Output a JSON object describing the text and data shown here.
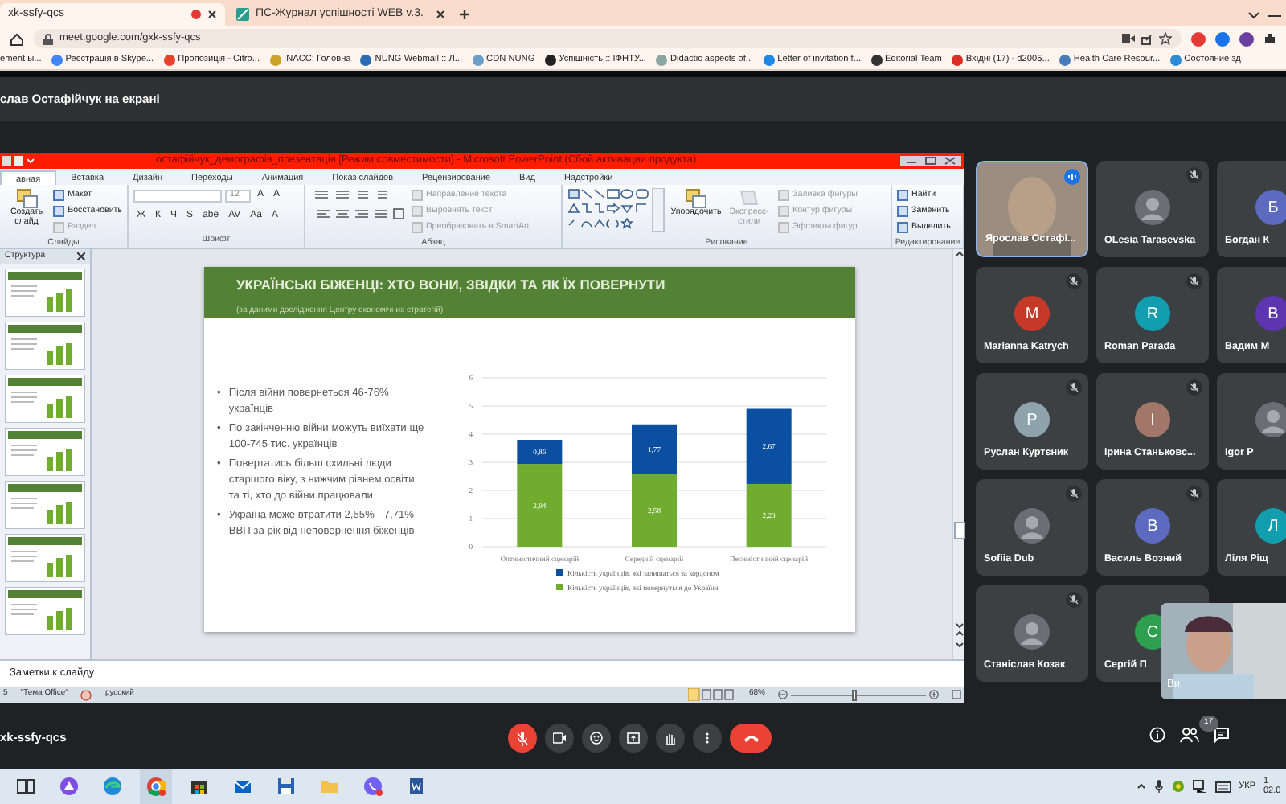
{
  "browser": {
    "tabs": [
      {
        "title": "xk-ssfy-qcs",
        "selected": true,
        "recording": true
      },
      {
        "title": "ПС-Журнал успішності WEB v.3.",
        "selected": false,
        "recording": false
      }
    ],
    "address": "meet.google.com/gxk-ssfy-qcs",
    "bookmarks": [
      {
        "label": "ement ы..."
      },
      {
        "label": "Реєстрація в Skype...",
        "color": "#4285f4"
      },
      {
        "label": "Пропозиція - Citro...",
        "color": "#e8412c"
      },
      {
        "label": "INACC: Головна",
        "color": "#c9a227"
      },
      {
        "label": "NUNG Webmail :: Л...",
        "color": "#2b6cb0"
      },
      {
        "label": "CDN NUNG",
        "color": "#6aa0c8"
      },
      {
        "label": "Успішність :: ІФНТУ...",
        "color": "#222222"
      },
      {
        "label": "Didactic aspects of...",
        "color": "#8aa8a0"
      },
      {
        "label": "Letter of invitation f...",
        "color": "#1e88e5"
      },
      {
        "label": "Editorial Team",
        "color": "#333333"
      },
      {
        "label": "Вхідні (17) - d2005...",
        "color": "#d93025"
      },
      {
        "label": "Health Care Resour...",
        "color": "#4a7bb7"
      },
      {
        "label": "Состояние зд",
        "color": "#2a8bd6"
      }
    ]
  },
  "meet": {
    "presenter_banner": "слав Остафійчук на екрані",
    "meeting_code": "xk-ssfy-qcs",
    "participant_count": "17",
    "self_label": "Ви",
    "mic_on": false
  },
  "powerpoint": {
    "title": "остафійчук_демографія_презентація [Режим совместимости]  -  Microsoft PowerPoint (Сбой активации продукта)",
    "tabs": [
      {
        "label": "авная",
        "selected": true
      },
      {
        "label": "Вставка",
        "selected": false
      },
      {
        "label": "Дизайн",
        "selected": false
      },
      {
        "label": "Переходы",
        "selected": false
      },
      {
        "label": "Анимация",
        "selected": false
      },
      {
        "label": "Показ слайдов",
        "selected": false
      },
      {
        "label": "Рецензирование",
        "selected": false
      },
      {
        "label": "Вид",
        "selected": false
      },
      {
        "label": "Надстройки",
        "selected": false
      }
    ],
    "ribbon": [
      {
        "label": "Слайды",
        "items": [
          {
            "kind": "large",
            "label": "Создать слайд",
            "disabled": false
          },
          {
            "kind": "stack",
            "entries": [
              {
                "label": "Макет",
                "disabled": false
              },
              {
                "label": "Восстановить",
                "disabled": false
              },
              {
                "label": "Раздел",
                "disabled": true
              }
            ]
          }
        ]
      },
      {
        "label": "Шрифт",
        "items": [
          {
            "kind": "font",
            "size": "12",
            "top_buttons": [
              "A",
              "A"
            ],
            "bottom_buttons": [
              "Ж",
              "К",
              "Ч",
              "S",
              "abe",
              "AV",
              "Aa",
              "A"
            ]
          }
        ]
      },
      {
        "label": "Абзац",
        "items": [
          {
            "kind": "para-tools"
          },
          {
            "kind": "stack",
            "entries": [
              {
                "label": "Направление текста",
                "disabled": true
              },
              {
                "label": "Выровнять текст",
                "disabled": true
              },
              {
                "label": "Преобразовать в SmartArt",
                "disabled": true
              }
            ]
          }
        ]
      },
      {
        "label": "Рисование",
        "items": [
          {
            "kind": "gallery"
          },
          {
            "kind": "large",
            "label": "Упорядочить",
            "disabled": false
          },
          {
            "kind": "large",
            "label": "Экспресс-стили",
            "disabled": true
          },
          {
            "kind": "stack",
            "entries": [
              {
                "label": "Заливка фигуры",
                "disabled": true
              },
              {
                "label": "Контур фигуры",
                "disabled": true
              },
              {
                "label": "Эффекты фигур",
                "disabled": true
              }
            ]
          }
        ]
      },
      {
        "label": "Редактирование",
        "items": [
          {
            "kind": "stack",
            "entries": [
              {
                "label": "Найти",
                "disabled": false
              },
              {
                "label": "Заменить",
                "disabled": false
              },
              {
                "label": "Выделить",
                "disabled": false
              }
            ]
          }
        ]
      }
    ],
    "outline_tab": "Структура",
    "slide": {
      "title": "УКРАЇНСЬКІ БІЖЕНЦІ: ХТО ВОНИ, ЗВІДКИ ТА ЯК ЇХ ПОВЕРНУТИ",
      "subtitle": "(за даними дослідження  Центру  економічних  стратегій)",
      "bullet_mark": "•",
      "bullets": [
        "Після війни повернеться 46-76% українців",
        "По закінченню війни можуть виїхати ще 100-745 тис. українців",
        "Повертатись більш схильні люди старшого віку, з нижчим рівнем освіти та ті, хто до війни працювали",
        "Україна може втратити 2,55% - 7,71% ВВП за рік від неповернення біженців"
      ],
      "chart_data": {
        "type": "bar",
        "stacked": true,
        "orientation": "vertical",
        "categories": [
          "Оптимістичний сценарій",
          "Середній сценарій",
          "Песимістичний сценарій"
        ],
        "series": [
          {
            "name": "Кількість українців, які повернуться до України",
            "color": "#70ad2f",
            "values": [
              2.94,
              2.58,
              2.23
            ],
            "value_labels": [
              "2,94",
              "2,58",
              "2,23"
            ]
          },
          {
            "name": "Кількість українців, які залишаться за кордоном",
            "color": "#0a4fa0",
            "values": [
              0.86,
              1.77,
              2.67
            ],
            "value_labels": [
              "0,86",
              "1,77",
              "2,67"
            ]
          }
        ],
        "ylim": [
          0,
          6
        ],
        "yticks": [
          0,
          1,
          2,
          3,
          4,
          5,
          6
        ],
        "data_labels": true,
        "grid": true,
        "legend": true
      }
    },
    "notes_prompt": "Заметки к слайду",
    "status_bar": {
      "slide": "5",
      "theme": "\"Тема Office\"",
      "language": "русский",
      "zoom": "68%",
      "zoom_slider": {
        "level": 0.45
      }
    }
  },
  "participants": [
    {
      "name": "Ярослав Остафі...",
      "kind": "video",
      "speaking": true,
      "muted": false
    },
    {
      "name": "OLesia Tarasevska",
      "kind": "photo",
      "speaking": false,
      "muted": true
    },
    {
      "name": "Богдан К",
      "kind": "initial",
      "initial": "Б",
      "color": "#5c6bc0",
      "speaking": false,
      "muted": false
    },
    {
      "name": "Marianna Katrych",
      "kind": "initial",
      "initial": "M",
      "color": "#c53929",
      "speaking": false,
      "muted": true
    },
    {
      "name": "Roman Parada",
      "kind": "initial",
      "initial": "R",
      "color": "#129eaf",
      "speaking": false,
      "muted": true
    },
    {
      "name": "Вадим М",
      "kind": "initial",
      "initial": "В",
      "color": "#5e35b1",
      "speaking": false,
      "muted": false
    },
    {
      "name": "Руслан Куртєник",
      "kind": "initial",
      "initial": "Р",
      "color": "#8fa3ad",
      "speaking": false,
      "muted": true
    },
    {
      "name": "Ірина Станьковс...",
      "kind": "initial",
      "initial": "І",
      "color": "#a1776a",
      "speaking": false,
      "muted": true
    },
    {
      "name": "Igor P",
      "kind": "photo",
      "speaking": false,
      "muted": false
    },
    {
      "name": "Sofiia Dub",
      "kind": "photo",
      "speaking": false,
      "muted": true
    },
    {
      "name": "Василь Возний",
      "kind": "initial",
      "initial": "В",
      "color": "#5c6bc0",
      "speaking": false,
      "muted": true
    },
    {
      "name": "Ліля Ріщ",
      "kind": "initial",
      "initial": "Л",
      "color": "#129eaf",
      "speaking": false,
      "muted": false
    },
    {
      "name": "Станіслав Козак",
      "kind": "photo",
      "speaking": false,
      "muted": true
    },
    {
      "name": "Сергій П",
      "kind": "initial",
      "initial": "С",
      "color": "#2e9e4f",
      "speaking": false,
      "muted": false
    }
  ],
  "taskbar": {
    "language": "УКР",
    "time": "1",
    "date": "02.0"
  }
}
